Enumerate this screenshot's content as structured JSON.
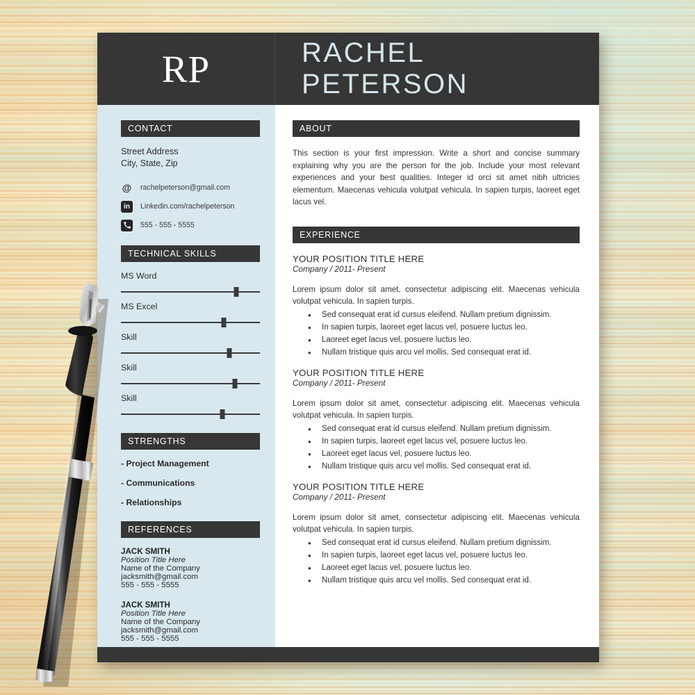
{
  "header": {
    "monogram": "RP",
    "name": "RACHEL PETERSON"
  },
  "colors": {
    "dark_bar": "#363636",
    "sidebar_bg": "#d9e8ef",
    "name_text": "#d4e4ea",
    "page_bg": "#ffffff"
  },
  "sidebar": {
    "contact": {
      "heading": "CONTACT",
      "address_line1": "Street Address",
      "address_line2": "City, State, Zip",
      "rows": [
        {
          "icon": "at-icon",
          "text": "rachelpeterson@gmail.com"
        },
        {
          "icon": "linkedin-icon",
          "text": "Linkedin.com/rachelpeterson"
        },
        {
          "icon": "phone-icon",
          "text": "555 - 555 - 5555"
        }
      ]
    },
    "skills": {
      "heading": "TECHNICAL SKILLS",
      "items": [
        {
          "label": "MS Word",
          "level": 83
        },
        {
          "label": "MS Excel",
          "level": 74
        },
        {
          "label": "Skill",
          "level": 78
        },
        {
          "label": "Skill",
          "level": 82
        },
        {
          "label": "Skill",
          "level": 73
        }
      ]
    },
    "strengths": {
      "heading": "STRENGTHS",
      "items": [
        "- Project Management",
        "- Communications",
        "- Relationships"
      ]
    },
    "references": {
      "heading": "REFERENCES",
      "items": [
        {
          "name": "JACK SMITH",
          "title": "Position Title Here",
          "company": "Name of the Company",
          "email": "jacksmith@gmail.com",
          "phone": "555 - 555 - 5555"
        },
        {
          "name": "JACK SMITH",
          "title": "Position Title Here",
          "company": "Name of the Company",
          "email": "jacksmith@gmail.com",
          "phone": "555 - 555 - 5555"
        }
      ]
    }
  },
  "main": {
    "about": {
      "heading": "ABOUT",
      "text": "This section is your first impression. Write a short and concise summary explaining why you are the person for the job. Include your most relevant experiences and your best qualities. Integer id orci sit amet nibh ultricies elementum. Maecenas vehicula volutpat vehicula. In sapien turpis, laoreet eget lacus vel."
    },
    "experience": {
      "heading": "EXPERIENCE",
      "items": [
        {
          "title": "YOUR POSITION TITLE HERE",
          "subtitle": "Company / 2011- Present",
          "paragraph": "Lorem ipsum dolor sit amet, consectetur adipiscing elit. Maecenas vehicula volutpat vehicula. In sapien turpis.",
          "bullets": [
            "Sed consequat erat id cursus eleifend. Nullam pretium dignissim.",
            "In sapien turpis, laoreet eget lacus vel, posuere luctus leo.",
            "Laoreet eget lacus vel, posuere luctus leo.",
            "Nullam tristique quis arcu vel mollis. Sed consequat erat id."
          ]
        },
        {
          "title": "YOUR POSITION TITLE HERE",
          "subtitle": "Company / 2011- Present",
          "paragraph": "Lorem ipsum dolor sit amet, consectetur adipiscing elit. Maecenas vehicula volutpat vehicula. In sapien turpis.",
          "bullets": [
            "Sed consequat erat id cursus eleifend. Nullam pretium dignissim.",
            "In sapien turpis, laoreet eget lacus vel, posuere luctus leo.",
            "Laoreet eget lacus vel, posuere luctus leo.",
            "Nullam tristique quis arcu vel mollis. Sed consequat erat id."
          ]
        },
        {
          "title": "YOUR POSITION TITLE HERE",
          "subtitle": "Company / 2011- Present",
          "paragraph": "Lorem ipsum dolor sit amet, consectetur adipiscing elit. Maecenas vehicula volutpat vehicula. In sapien turpis.",
          "bullets": [
            "Sed consequat erat id cursus eleifend. Nullam pretium dignissim.",
            "In sapien turpis, laoreet eget lacus vel, posuere luctus leo.",
            "Laoreet eget lacus vel, posuere luctus leo.",
            "Nullam tristique quis arcu vel mollis. Sed consequat erat id."
          ]
        }
      ]
    }
  },
  "decor": {
    "pen": "fountain-pen"
  }
}
